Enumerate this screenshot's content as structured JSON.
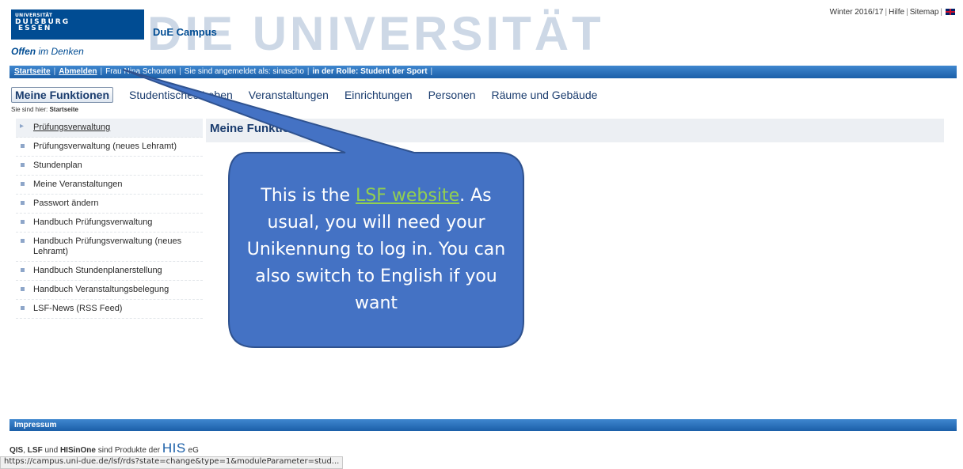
{
  "logo": {
    "line1": "UNIVERSITÄT",
    "line2": "DUISBURG",
    "line3": "ESSEN",
    "tagline_bold": "Offen",
    "tagline_rest": " im Denken"
  },
  "header": {
    "campus": "DuE Campus",
    "watermark": "DIE UNIVERSITÄT",
    "semester": "Winter 2016/17",
    "help": "Hilfe",
    "sitemap": "Sitemap",
    "language_icon": "uk-flag-icon"
  },
  "navbar": {
    "home": "Startseite",
    "logout": "Abmelden",
    "user": "Frau Nina Schouten",
    "logged_in_as": "Sie sind angemeldet als: sinascho",
    "role": "in der Rolle: Student der Sport"
  },
  "tabs": {
    "active": "Meine Funktionen",
    "items": [
      "Studentisches Leben",
      "Veranstaltungen",
      "Einrichtungen",
      "Personen",
      "Räume und Gebäude"
    ]
  },
  "breadcrumb": {
    "prefix": "Sie sind hier: ",
    "current": "Startseite"
  },
  "sidebar": {
    "items": [
      "Prüfungsverwaltung",
      "Prüfungsverwaltung (neues Lehramt)",
      "Stundenplan",
      "Meine Veranstaltungen",
      "Passwort ändern",
      "Handbuch Prüfungsverwaltung",
      "Handbuch Prüfungsverwaltung (neues Lehramt)",
      "Handbuch Stundenplanerstellung",
      "Handbuch Veranstaltungsbelegung",
      "LSF-News (RSS Feed)"
    ]
  },
  "main": {
    "heading": "Meine Funktionen"
  },
  "callout": {
    "before_link": "This is the ",
    "link": "LSF website",
    "after_link": ". As usual, you will need your Unikennung to log in. You can also switch to English if you want"
  },
  "footer": {
    "impressum": "Impressum",
    "qis": "QIS",
    "comma": ", ",
    "lsf": "LSF",
    "und": " und ",
    "hisinone": "HISinOne",
    "products": " sind Produkte der ",
    "his": "HIS",
    "eg": " eG",
    "status_url": "https://campus.uni-due.de/lsf/rds?state=change&type=1&moduleParameter=stud..."
  },
  "colors": {
    "brand_blue": "#004c93",
    "navbar": "#1b5fa8",
    "callout_fill": "#4472c4",
    "callout_border": "#2f528f",
    "callout_link": "#92d050"
  }
}
